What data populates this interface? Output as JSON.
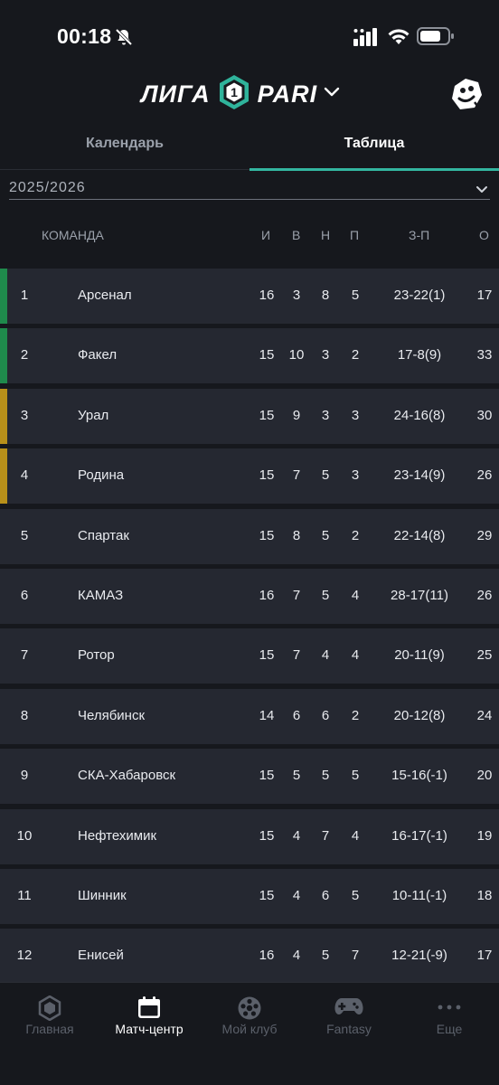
{
  "status_bar": {
    "time": "00:18"
  },
  "header": {
    "brand_left": "ЛИГА",
    "brand_number": "1",
    "brand_right": "PARI"
  },
  "tabs": [
    {
      "label": "Календарь",
      "active": false
    },
    {
      "label": "Таблица",
      "active": true
    }
  ],
  "season": {
    "value": "2025/2026"
  },
  "table": {
    "columns": {
      "team": "КОМАНДА",
      "played": "И",
      "won": "В",
      "drawn": "Н",
      "lost": "П",
      "goals": "З-П",
      "points": "О"
    },
    "zone_colors": {
      "promotion": "#1f8a4c",
      "playoff": "#b8901a"
    },
    "rows": [
      {
        "pos": "1",
        "team": "Арсенал",
        "played": "16",
        "won": "3",
        "drawn": "8",
        "lost": "5",
        "goals": "23-22(1)",
        "points": "17",
        "zone": "promotion"
      },
      {
        "pos": "2",
        "team": "Факел",
        "played": "15",
        "won": "10",
        "drawn": "3",
        "lost": "2",
        "goals": "17-8(9)",
        "points": "33",
        "zone": "promotion"
      },
      {
        "pos": "3",
        "team": "Урал",
        "played": "15",
        "won": "9",
        "drawn": "3",
        "lost": "3",
        "goals": "24-16(8)",
        "points": "30",
        "zone": "playoff"
      },
      {
        "pos": "4",
        "team": "Родина",
        "played": "15",
        "won": "7",
        "drawn": "5",
        "lost": "3",
        "goals": "23-14(9)",
        "points": "26",
        "zone": "playoff"
      },
      {
        "pos": "5",
        "team": "Спартак",
        "played": "15",
        "won": "8",
        "drawn": "5",
        "lost": "2",
        "goals": "22-14(8)",
        "points": "29",
        "zone": ""
      },
      {
        "pos": "6",
        "team": "КАМАЗ",
        "played": "16",
        "won": "7",
        "drawn": "5",
        "lost": "4",
        "goals": "28-17(11)",
        "points": "26",
        "zone": ""
      },
      {
        "pos": "7",
        "team": "Ротор",
        "played": "15",
        "won": "7",
        "drawn": "4",
        "lost": "4",
        "goals": "20-11(9)",
        "points": "25",
        "zone": ""
      },
      {
        "pos": "8",
        "team": "Челябинск",
        "played": "14",
        "won": "6",
        "drawn": "6",
        "lost": "2",
        "goals": "20-12(8)",
        "points": "24",
        "zone": ""
      },
      {
        "pos": "9",
        "team": "СКА-Хабаровск",
        "played": "15",
        "won": "5",
        "drawn": "5",
        "lost": "5",
        "goals": "15-16(-1)",
        "points": "20",
        "zone": ""
      },
      {
        "pos": "10",
        "team": "Нефтехимик",
        "played": "15",
        "won": "4",
        "drawn": "7",
        "lost": "4",
        "goals": "16-17(-1)",
        "points": "19",
        "zone": ""
      },
      {
        "pos": "11",
        "team": "Шинник",
        "played": "15",
        "won": "4",
        "drawn": "6",
        "lost": "5",
        "goals": "10-11(-1)",
        "points": "18",
        "zone": ""
      },
      {
        "pos": "12",
        "team": "Енисей",
        "played": "16",
        "won": "4",
        "drawn": "5",
        "lost": "7",
        "goals": "12-21(-9)",
        "points": "17",
        "zone": ""
      }
    ]
  },
  "bottom_nav": [
    {
      "label": "Главная",
      "icon": "league-home-icon",
      "active": false
    },
    {
      "label": "Матч-центр",
      "icon": "calendar-icon",
      "active": true
    },
    {
      "label": "Мой клуб",
      "icon": "football-icon",
      "active": false
    },
    {
      "label": "Fantasy",
      "icon": "gamepad-icon",
      "active": false
    },
    {
      "label": "Еще",
      "icon": "more-dots-icon",
      "active": false
    }
  ]
}
